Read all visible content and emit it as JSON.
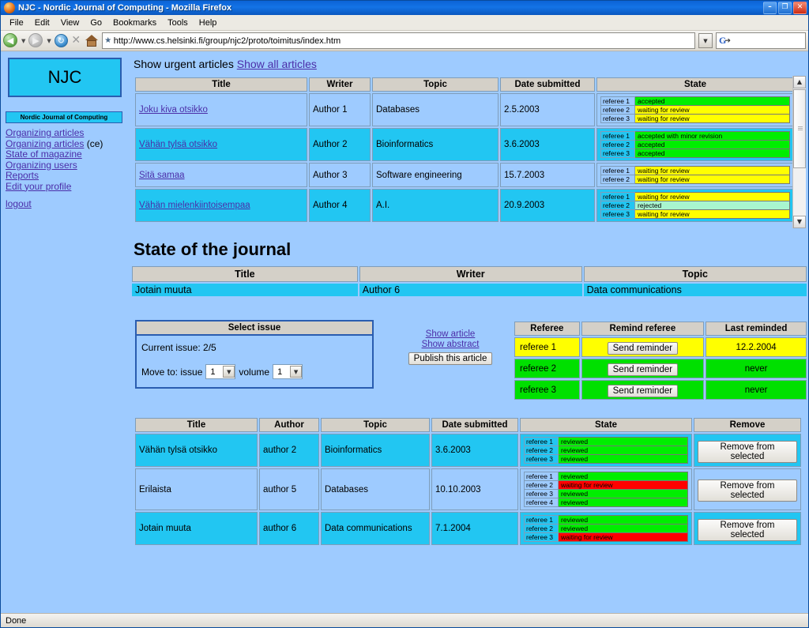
{
  "window": {
    "title": "NJC - Nordic Journal of Computing - Mozilla Firefox",
    "minimize_label": "–",
    "maximize_label": "❐",
    "close_label": "✕"
  },
  "menubar": {
    "items": [
      "File",
      "Edit",
      "View",
      "Go",
      "Bookmarks",
      "Tools",
      "Help"
    ]
  },
  "toolbar": {
    "back_icon": "back-arrow-icon",
    "forward_icon": "forward-arrow-icon",
    "reload_icon": "reload-icon",
    "stop_icon": "stop-icon",
    "home_icon": "home-icon",
    "url": "http://www.cs.helsinki.fi/group/njc2/proto/toimitus/index.htm",
    "url_favicon": "page-favicon",
    "url_dropdown_icon": "chevron-down-icon",
    "search_value": "G",
    "search_icon": "google-search-icon"
  },
  "statusbar": {
    "text": "Done"
  },
  "sidebar": {
    "logo": "NJC",
    "subtitle": "Nordic Journal of Computing",
    "links": [
      {
        "label": "Organizing articles",
        "suffix": ""
      },
      {
        "label": "Organizing articles",
        "suffix": " (ce)"
      },
      {
        "label": "State of magazine",
        "suffix": ""
      },
      {
        "label": "Organizing users",
        "suffix": ""
      },
      {
        "label": "Reports",
        "suffix": ""
      },
      {
        "label": "Edit your profile",
        "suffix": ""
      }
    ],
    "logout": "logout"
  },
  "top": {
    "heading_plain": "Show urgent articles",
    "heading_link": "Show all articles",
    "columns": [
      "Title",
      "Writer",
      "Topic",
      "Date submitted",
      "State"
    ],
    "rows": [
      {
        "title": "Joku kiva otsikko",
        "writer": "Author 1",
        "topic": "Databases",
        "date": "2.5.2003",
        "shade": "lt",
        "states": [
          {
            "referee": "referee 1",
            "state": "accepted",
            "color": "s-green"
          },
          {
            "referee": "referee 2",
            "state": "waiting for review",
            "color": "s-yellow"
          },
          {
            "referee": "referee 3",
            "state": "waiting for review",
            "color": "s-yellow"
          }
        ]
      },
      {
        "title": "Vähän tylsä otsikko",
        "writer": "Author 2",
        "topic": "Bioinformatics",
        "date": "3.6.2003",
        "shade": "dk",
        "states": [
          {
            "referee": "referee 1",
            "state": "accepted with minor revision",
            "color": "s-green"
          },
          {
            "referee": "referee 2",
            "state": "accepted",
            "color": "s-green"
          },
          {
            "referee": "referee 3",
            "state": "accepted",
            "color": "s-green"
          }
        ]
      },
      {
        "title": "Sitä samaa",
        "writer": "Author 3",
        "topic": "Software engineering",
        "date": "15.7.2003",
        "shade": "lt",
        "states": [
          {
            "referee": "referee 1",
            "state": "waiting for review",
            "color": "s-yellow"
          },
          {
            "referee": "referee 2",
            "state": "waiting for review",
            "color": "s-yellow"
          }
        ]
      },
      {
        "title": "Vähän mielenkiintoisempaa",
        "writer": "Author 4",
        "topic": "A.I.",
        "date": "20.9.2003",
        "shade": "dk",
        "states": [
          {
            "referee": "referee 1",
            "state": "waiting for review",
            "color": "s-yellow"
          },
          {
            "referee": "referee 2",
            "state": "rejected",
            "color": "s-mint"
          },
          {
            "referee": "referee 3",
            "state": "waiting for review",
            "color": "s-yellow"
          }
        ]
      }
    ],
    "scroll_up_icon": "scroll-up-arrow-icon",
    "scroll_down_icon": "scroll-down-arrow-icon"
  },
  "journal": {
    "title": "State of the journal",
    "columns": [
      "Title",
      "Writer",
      "Topic"
    ],
    "row": {
      "title": "Jotain muuta",
      "writer": "Author 6",
      "topic": "Data communications"
    }
  },
  "select_issue": {
    "header": "Select issue",
    "current_label": "Current issue: 2/5",
    "move_label": "Move to: issue",
    "issue_value": "1",
    "volume_label": "volume",
    "volume_value": "1",
    "dropdown_icon": "chevron-down-icon"
  },
  "publish": {
    "show_article": "Show article",
    "show_abstract": "Show abstract",
    "button": "Publish this article"
  },
  "referees": {
    "columns": [
      "Referee",
      "Remind referee",
      "Last reminded"
    ],
    "rows": [
      {
        "name": "referee 1",
        "button": "Send reminder",
        "last": "12.2.2004",
        "color": "r-yellow"
      },
      {
        "name": "referee 2",
        "button": "Send reminder",
        "last": "never",
        "color": "r-green"
      },
      {
        "name": "referee 3",
        "button": "Send reminder",
        "last": "never",
        "color": "r-green"
      }
    ]
  },
  "bottom": {
    "columns": [
      "Title",
      "Author",
      "Topic",
      "Date submitted",
      "State",
      "Remove"
    ],
    "rows": [
      {
        "title": "Vähän tylsä otsikko",
        "author": "author 2",
        "topic": "Bioinformatics",
        "date": "3.6.2003",
        "shade": "dk",
        "remove": "Remove from selected",
        "states": [
          {
            "referee": "referee 1",
            "state": "reviewed",
            "color": "s-green"
          },
          {
            "referee": "referee 2",
            "state": "reviewed",
            "color": "s-green"
          },
          {
            "referee": "referee 3",
            "state": "reviewed",
            "color": "s-green"
          }
        ]
      },
      {
        "title": "Erilaista",
        "author": "author 5",
        "topic": "Databases",
        "date": "10.10.2003",
        "shade": "lt",
        "remove": "Remove from selected",
        "states": [
          {
            "referee": "referee 1",
            "state": "reviewed",
            "color": "s-green"
          },
          {
            "referee": "referee 2",
            "state": "waiting for review",
            "color": "s-red"
          },
          {
            "referee": "referee 3",
            "state": "reviewed",
            "color": "s-green"
          },
          {
            "referee": "referee 4",
            "state": "reviewed",
            "color": "s-green"
          }
        ]
      },
      {
        "title": "Jotain muuta",
        "author": "author 6",
        "topic": "Data communications",
        "date": "7.1.2004",
        "shade": "dk",
        "remove": "Remove from selected",
        "states": [
          {
            "referee": "referee 1",
            "state": "reviewed",
            "color": "s-green"
          },
          {
            "referee": "referee 2",
            "state": "reviewed",
            "color": "s-green"
          },
          {
            "referee": "referee 3",
            "state": "waiting for review",
            "color": "s-red"
          }
        ]
      }
    ]
  },
  "colors": {
    "page_bg": "#9ecbff",
    "row_dark": "#22c6f2",
    "accent_border": "#2a5db0",
    "header_bg": "#d4d0c8",
    "link": "#4b2ea8",
    "state_green": "#00ee00",
    "state_yellow": "#ffff00",
    "state_mint": "#a8f5cf",
    "state_red": "#ff0000"
  }
}
